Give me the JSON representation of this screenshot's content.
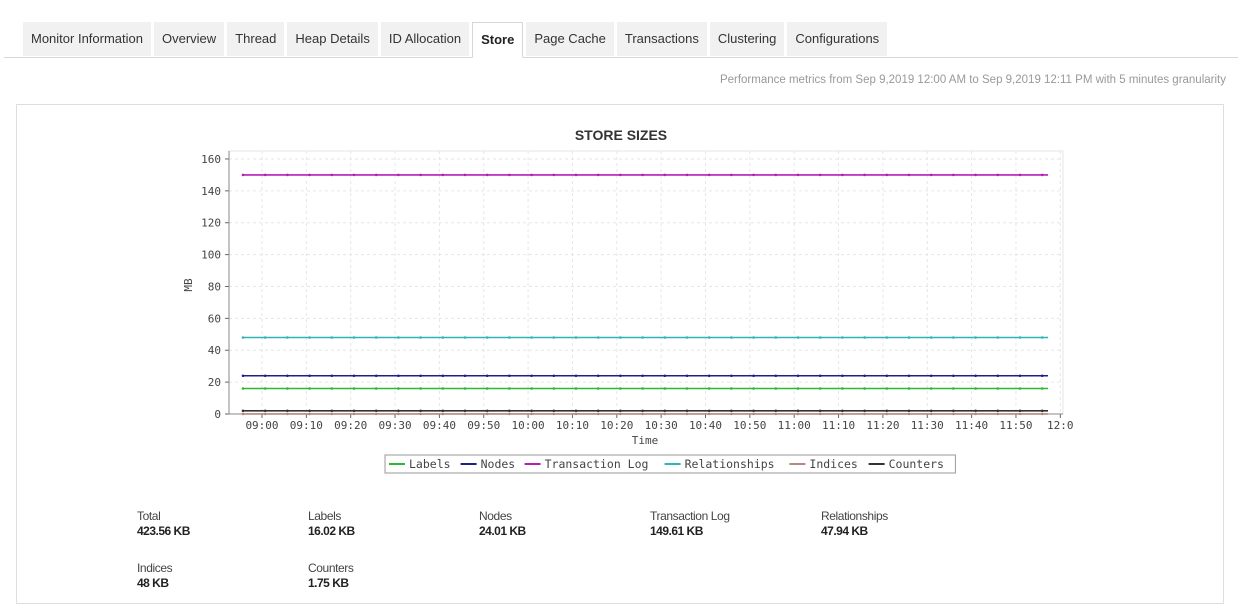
{
  "tabs": [
    {
      "label": "Monitor Information",
      "active": false
    },
    {
      "label": "Overview",
      "active": false
    },
    {
      "label": "Thread",
      "active": false
    },
    {
      "label": "Heap Details",
      "active": false
    },
    {
      "label": "ID Allocation",
      "active": false
    },
    {
      "label": "Store",
      "active": true
    },
    {
      "label": "Page Cache",
      "active": false
    },
    {
      "label": "Transactions",
      "active": false
    },
    {
      "label": "Clustering",
      "active": false
    },
    {
      "label": "Configurations",
      "active": false
    }
  ],
  "range_text": "Performance metrics from Sep 9,2019 12:00 AM to Sep 9,2019 12:11 PM with 5 minutes granularity",
  "chart_data": {
    "type": "line",
    "title": "STORE SIZES",
    "xlabel": "Time",
    "ylabel": "MB",
    "ylim": [
      0,
      165
    ],
    "yticks": [
      0,
      20,
      40,
      60,
      80,
      100,
      120,
      140,
      160
    ],
    "x": [
      "09:00",
      "09:10",
      "09:20",
      "09:30",
      "09:40",
      "09:50",
      "10:00",
      "10:10",
      "10:20",
      "10:30",
      "10:40",
      "10:50",
      "11:00",
      "11:10",
      "11:20",
      "11:30",
      "11:40",
      "11:50",
      "12:0"
    ],
    "grid": true,
    "legend_position": "bottom",
    "series": [
      {
        "name": "Labels",
        "color": "#2db82d",
        "value": 16
      },
      {
        "name": "Nodes",
        "color": "#1f1f8a",
        "value": 24
      },
      {
        "name": "Transaction Log",
        "color": "#b51fb5",
        "value": 150
      },
      {
        "name": "Relationships",
        "color": "#2fb5b5",
        "value": 48
      },
      {
        "name": "Indices",
        "color": "#b08a7e",
        "value": 0.05
      },
      {
        "name": "Counters",
        "color": "#333333",
        "value": 2
      }
    ]
  },
  "stats": [
    {
      "label": "Total",
      "value": "423.56 KB"
    },
    {
      "label": "Labels",
      "value": "16.02 KB"
    },
    {
      "label": "Nodes",
      "value": "24.01 KB"
    },
    {
      "label": "Transaction Log",
      "value": "149.61 KB"
    },
    {
      "label": "Relationships",
      "value": "47.94 KB"
    },
    {
      "label": "Indices",
      "value": "48 KB"
    },
    {
      "label": "Counters",
      "value": "1.75 KB"
    }
  ]
}
